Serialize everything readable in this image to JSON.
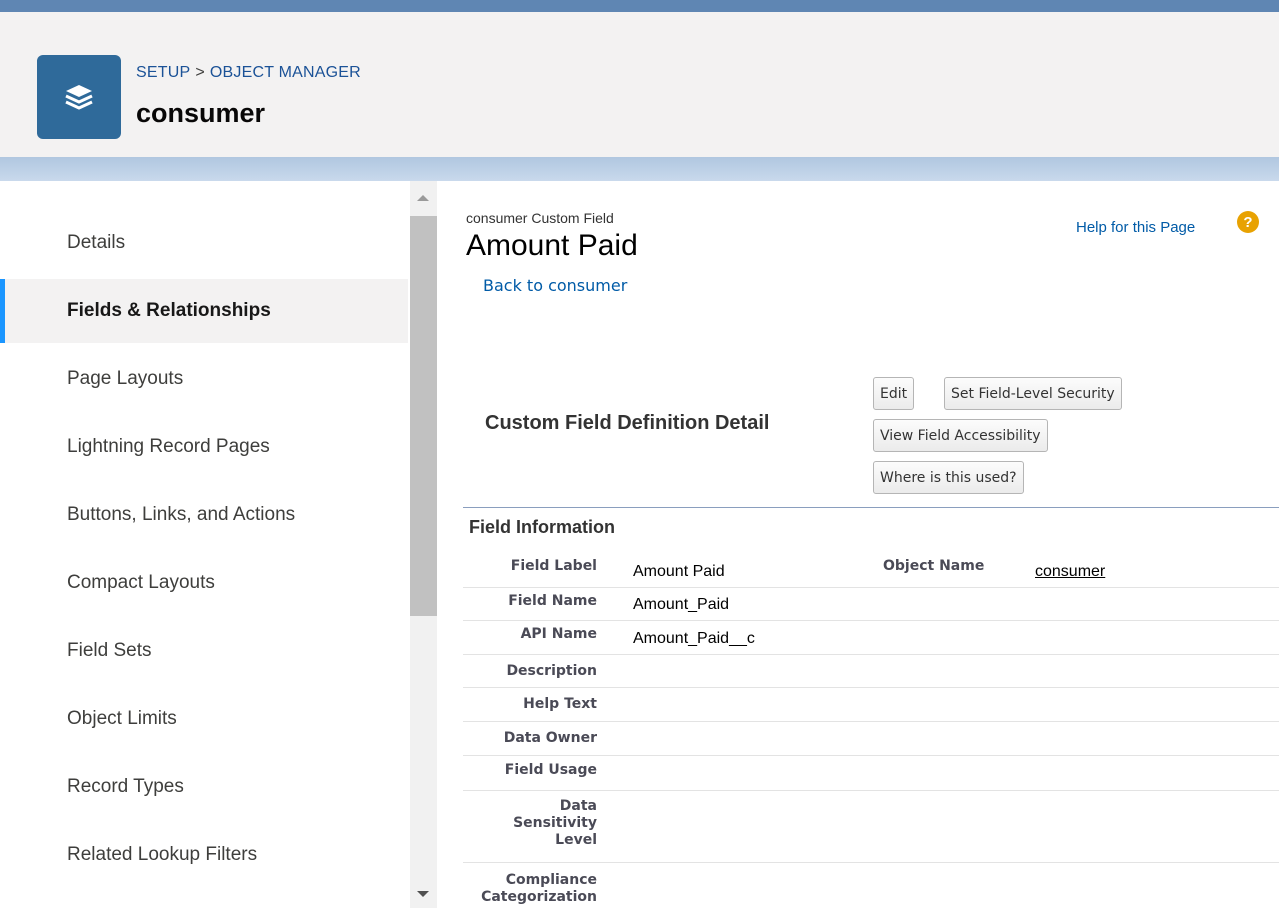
{
  "header": {
    "breadcrumb": [
      "SETUP",
      "OBJECT MANAGER"
    ],
    "breadcrumb_separator": ">",
    "object_title": "consumer",
    "icon": "layers-icon"
  },
  "sidebar": {
    "items": [
      {
        "label": "Details",
        "active": false
      },
      {
        "label": "Fields & Relationships",
        "active": true
      },
      {
        "label": "Page Layouts",
        "active": false
      },
      {
        "label": "Lightning Record Pages",
        "active": false
      },
      {
        "label": "Buttons, Links, and Actions",
        "active": false
      },
      {
        "label": "Compact Layouts",
        "active": false
      },
      {
        "label": "Field Sets",
        "active": false
      },
      {
        "label": "Object Limits",
        "active": false
      },
      {
        "label": "Record Types",
        "active": false
      },
      {
        "label": "Related Lookup Filters",
        "active": false
      }
    ]
  },
  "content": {
    "pre_title": "consumer Custom Field",
    "title": "Amount Paid",
    "back_link": "Back to consumer",
    "help_link": "Help for this Page",
    "help_icon": "question-icon",
    "section_title": "Custom Field Definition Detail",
    "buttons": {
      "edit": "Edit",
      "set_fls": "Set Field-Level Security",
      "view_access": "View Field Accessibility",
      "where_used": "Where is this used?"
    },
    "field_info_title": "Field Information",
    "fields": [
      {
        "label": "Field Label",
        "value": "Amount Paid"
      },
      {
        "label": "Field Name",
        "value": "Amount_Paid"
      },
      {
        "label": "API Name",
        "value": "Amount_Paid__c"
      },
      {
        "label": "Description",
        "value": ""
      },
      {
        "label": "Help Text",
        "value": ""
      },
      {
        "label": "Data Owner",
        "value": ""
      },
      {
        "label": "Field Usage",
        "value": ""
      },
      {
        "label": "Data Sensitivity Level",
        "value": ""
      },
      {
        "label": "Compliance Categorization",
        "value": ""
      }
    ],
    "object_name_label": "Object Name",
    "object_name_value": "consumer"
  },
  "colors": {
    "accent": "#1b96ff",
    "link": "#015ba7",
    "icon_bg": "#2f6a9a",
    "help_icon_bg": "#e8a202"
  }
}
